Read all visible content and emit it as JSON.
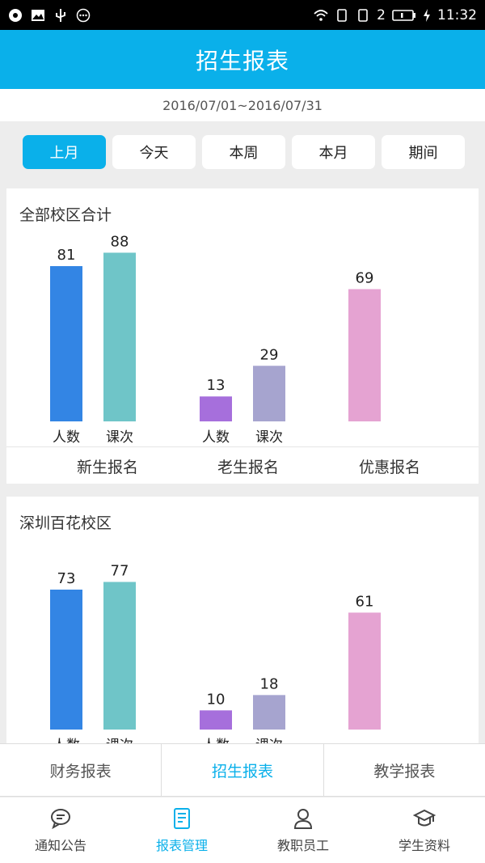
{
  "status_bar": {
    "time": "11:32",
    "sim": "2"
  },
  "header": {
    "title": "招生报表"
  },
  "date_range": "2016/07/01~2016/07/31",
  "filters": [
    {
      "label": "上月",
      "active": true
    },
    {
      "label": "今天",
      "active": false
    },
    {
      "label": "本周",
      "active": false
    },
    {
      "label": "本月",
      "active": false
    },
    {
      "label": "期间",
      "active": false
    }
  ],
  "colors": {
    "accent": "#0ab0ea",
    "new_people": "#3385e4",
    "new_lessons": "#6fc5c8",
    "old_people": "#a66fdc",
    "old_lessons": "#a6a4cf",
    "discount": "#e5a3d2"
  },
  "groups": [
    "新生报名",
    "老生报名",
    "优惠报名"
  ],
  "bar_labels": {
    "people": "人数",
    "lessons": "课次"
  },
  "chart_data": [
    {
      "type": "bar",
      "title": "全部校区合计",
      "groups": [
        "新生报名",
        "老生报名",
        "优惠报名"
      ],
      "series": [
        {
          "group": "新生报名",
          "name": "人数",
          "value": 81
        },
        {
          "group": "新生报名",
          "name": "课次",
          "value": 88
        },
        {
          "group": "老生报名",
          "name": "人数",
          "value": 13
        },
        {
          "group": "老生报名",
          "name": "课次",
          "value": 29
        },
        {
          "group": "优惠报名",
          "name": "",
          "value": 69
        }
      ]
    },
    {
      "type": "bar",
      "title": "深圳百花校区",
      "groups": [
        "新生报名",
        "老生报名",
        "优惠报名"
      ],
      "series": [
        {
          "group": "新生报名",
          "name": "人数",
          "value": 73
        },
        {
          "group": "新生报名",
          "name": "课次",
          "value": 77
        },
        {
          "group": "老生报名",
          "name": "人数",
          "value": 10
        },
        {
          "group": "老生报名",
          "name": "课次",
          "value": 18
        },
        {
          "group": "优惠报名",
          "name": "",
          "value": 61
        }
      ]
    }
  ],
  "report_tabs": [
    {
      "label": "财务报表",
      "active": false
    },
    {
      "label": "招生报表",
      "active": true
    },
    {
      "label": "教学报表",
      "active": false
    }
  ],
  "bottom_nav": [
    {
      "label": "通知公告",
      "icon": "chat-bubble-icon",
      "active": false
    },
    {
      "label": "报表管理",
      "icon": "report-icon",
      "active": true
    },
    {
      "label": "教职员工",
      "icon": "person-icon",
      "active": false
    },
    {
      "label": "学生资料",
      "icon": "graduation-cap-icon",
      "active": false
    }
  ]
}
